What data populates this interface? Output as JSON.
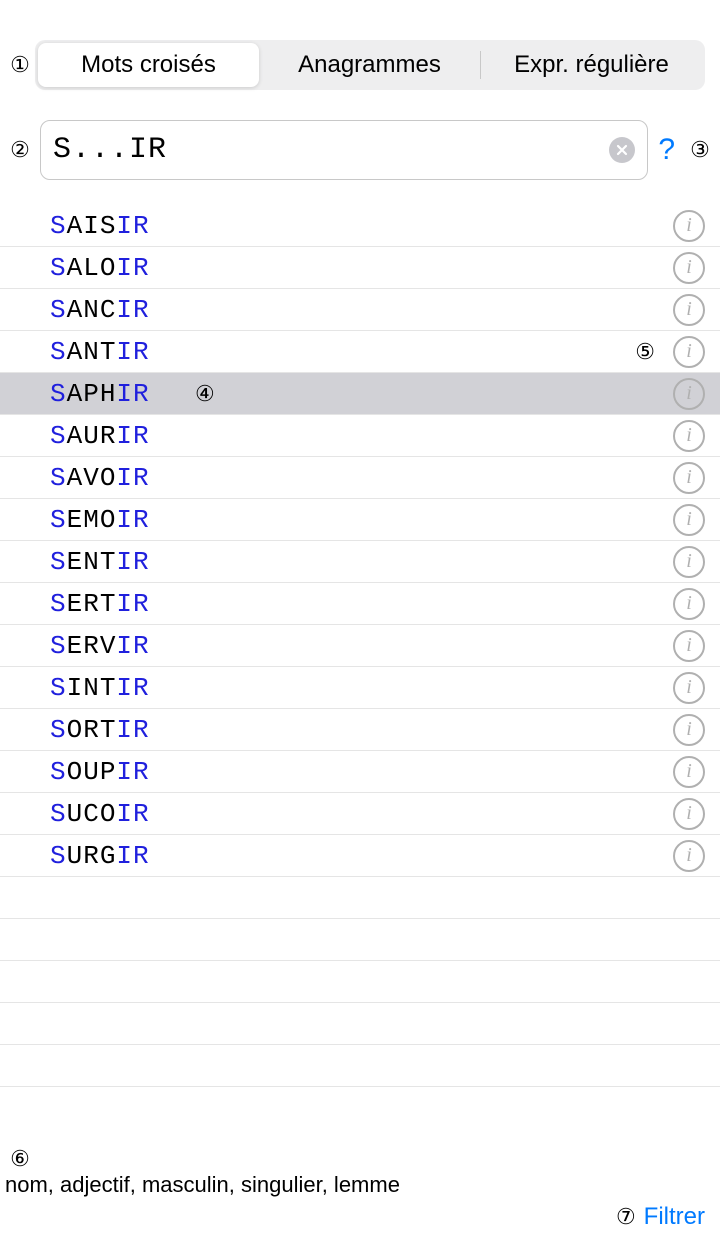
{
  "annotations": {
    "a1": "①",
    "a2": "②",
    "a3": "③",
    "a4": "④",
    "a5": "⑤",
    "a6": "⑥",
    "a7": "⑦"
  },
  "tabs": {
    "crosswords": "Mots croisés",
    "anagrams": "Anagrammes",
    "regex": "Expr. régulière"
  },
  "search": {
    "value": "S...IR",
    "help": "?"
  },
  "results": [
    {
      "prefix": "S",
      "mid": "AIS",
      "suffix": "IR",
      "selected": false
    },
    {
      "prefix": "S",
      "mid": "ALO",
      "suffix": "IR",
      "selected": false
    },
    {
      "prefix": "S",
      "mid": "ANC",
      "suffix": "IR",
      "selected": false
    },
    {
      "prefix": "S",
      "mid": "ANT",
      "suffix": "IR",
      "selected": false,
      "ann5": true
    },
    {
      "prefix": "S",
      "mid": "APH",
      "suffix": "IR",
      "selected": true,
      "ann4": true
    },
    {
      "prefix": "S",
      "mid": "AUR",
      "suffix": "IR",
      "selected": false
    },
    {
      "prefix": "S",
      "mid": "AVO",
      "suffix": "IR",
      "selected": false
    },
    {
      "prefix": "S",
      "mid": "EMO",
      "suffix": "IR",
      "selected": false
    },
    {
      "prefix": "S",
      "mid": "ENT",
      "suffix": "IR",
      "selected": false
    },
    {
      "prefix": "S",
      "mid": "ERT",
      "suffix": "IR",
      "selected": false
    },
    {
      "prefix": "S",
      "mid": "ERV",
      "suffix": "IR",
      "selected": false
    },
    {
      "prefix": "S",
      "mid": "INT",
      "suffix": "IR",
      "selected": false
    },
    {
      "prefix": "S",
      "mid": "ORT",
      "suffix": "IR",
      "selected": false
    },
    {
      "prefix": "S",
      "mid": "OUP",
      "suffix": "IR",
      "selected": false
    },
    {
      "prefix": "S",
      "mid": "UCO",
      "suffix": "IR",
      "selected": false
    },
    {
      "prefix": "S",
      "mid": "URG",
      "suffix": "IR",
      "selected": false
    }
  ],
  "info_glyph": "i",
  "bottom": {
    "description": "nom, adjectif, masculin, singulier, lemme",
    "filter": "Filtrer"
  },
  "empty_rows": 5
}
